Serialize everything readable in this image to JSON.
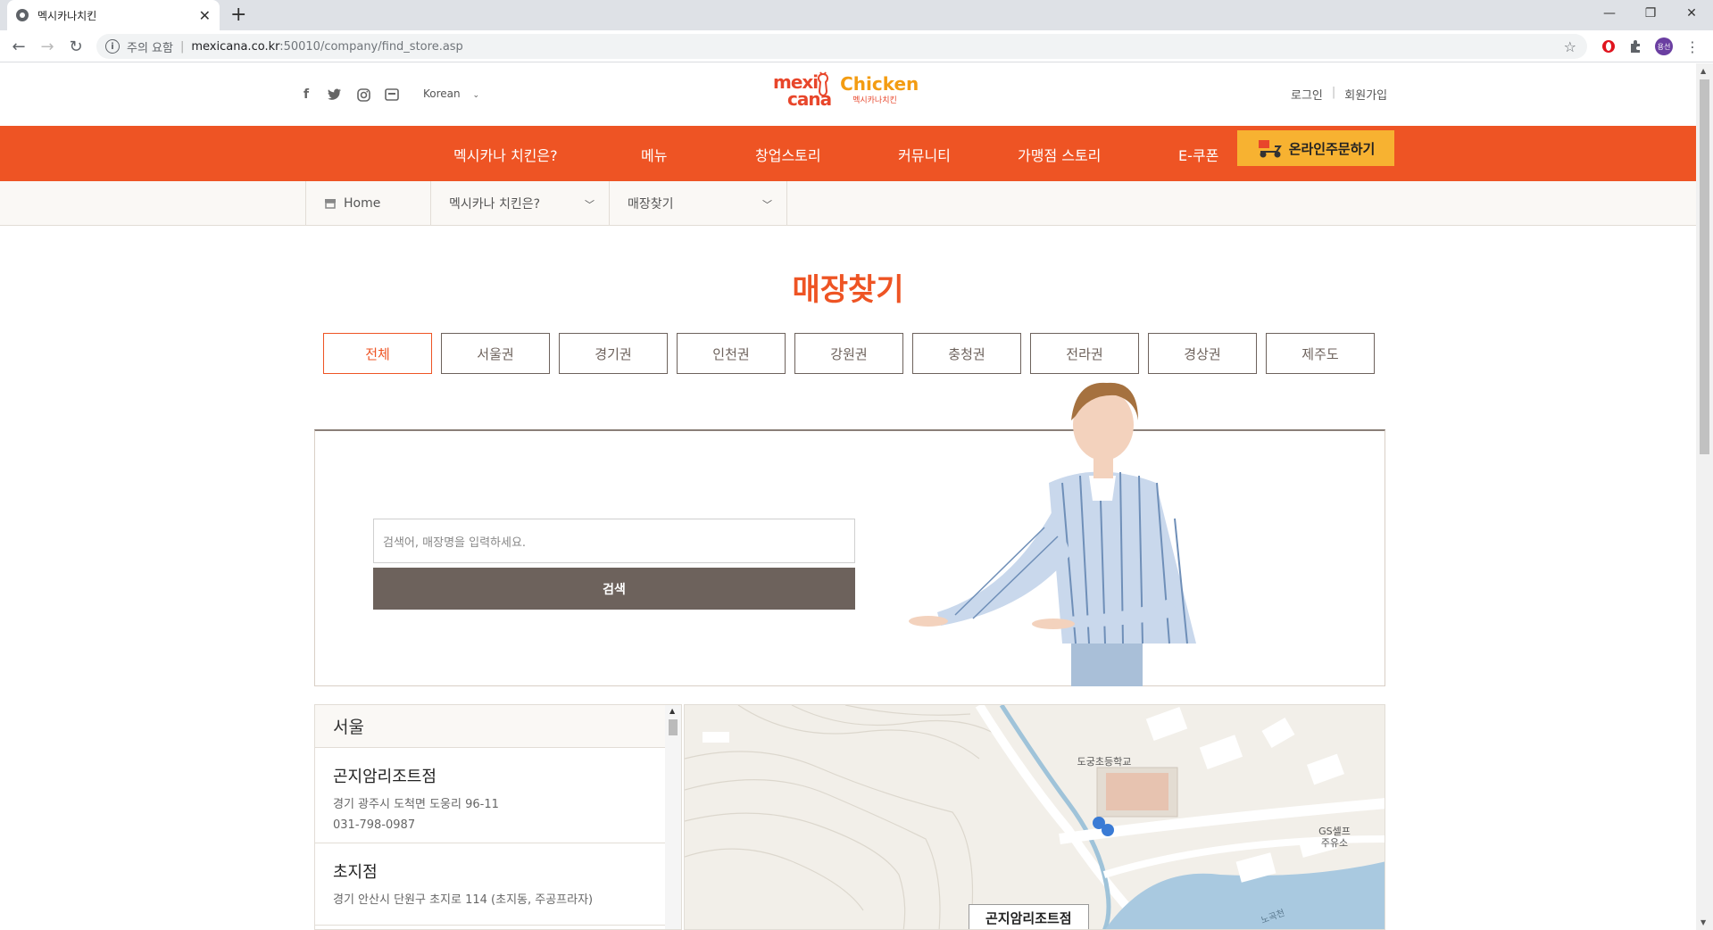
{
  "browser": {
    "tab_title": "멕시카나치킨",
    "security_warning": "주의 요함",
    "url_host": "mexicana.co.kr",
    "url_rest": ":50010/company/find_store.asp",
    "profile_initials": "용선"
  },
  "header": {
    "language": "Korean",
    "logo_text_1": "mexi",
    "logo_text_2": "cana",
    "logo_text_en": "Chicken",
    "logo_text_ko": "멕시카나치킨",
    "login": "로그인",
    "signup": "회원가입"
  },
  "gnb": {
    "items": [
      "멕시카나 치킨은?",
      "메뉴",
      "창업스토리",
      "커뮤니티",
      "가맹점 스토리",
      "E-쿠폰"
    ],
    "order_button": "온라인주문하기"
  },
  "subnav": {
    "home": "Home",
    "section": "멕시카나 치킨은?",
    "page": "매장찾기"
  },
  "page_title": "매장찾기",
  "regions": [
    "전체",
    "서울권",
    "경기권",
    "인천권",
    "강원권",
    "충청권",
    "전라권",
    "경상권",
    "제주도"
  ],
  "active_region": "전체",
  "search": {
    "placeholder": "검색어, 매장명을 입력하세요.",
    "button": "검색"
  },
  "store_list": {
    "region": "서울",
    "stores": [
      {
        "name": "곤지암리조트점",
        "address": "경기 광주시 도척면 도웅리 96-11",
        "tel": "031-798-0987"
      },
      {
        "name": "초지점",
        "address": "경기 안산시 단원구 초지로 114 (초지동, 주공프라자)",
        "tel": ""
      }
    ]
  },
  "map": {
    "label": "곤지암리조트점",
    "school": "도궁초등학교",
    "gas_station_1": "GS셀프",
    "gas_station_2": "주유소",
    "river": "노곡천"
  },
  "colors": {
    "brand_orange": "#ee5424",
    "order_yellow": "#f7b231",
    "button_brown": "#6d625c"
  }
}
